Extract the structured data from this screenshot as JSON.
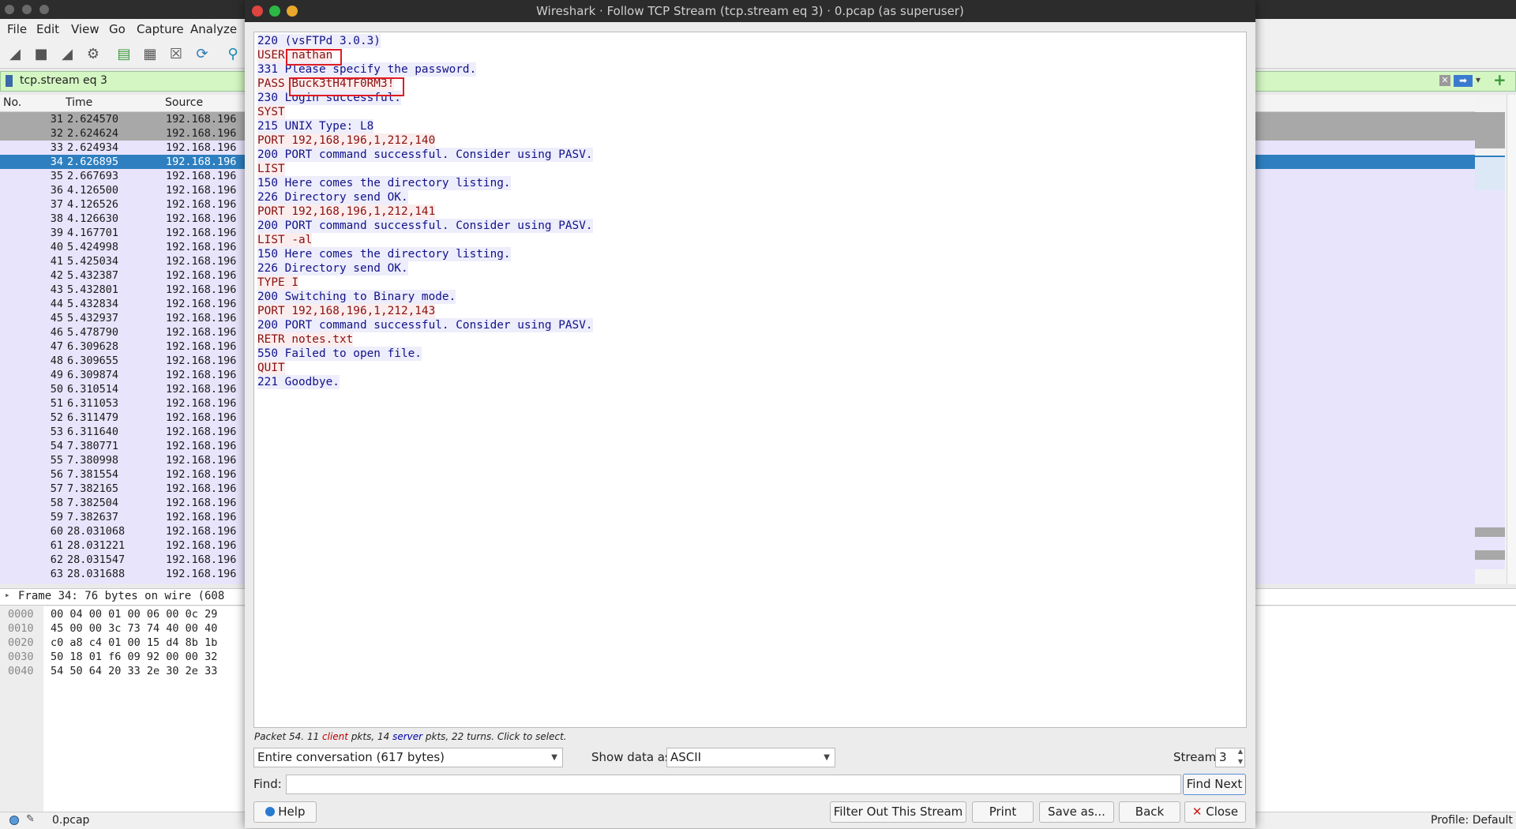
{
  "menu": [
    "File",
    "Edit",
    "View",
    "Go",
    "Capture",
    "Analyze"
  ],
  "filter": {
    "value": "tcp.stream eq 3"
  },
  "columns": {
    "no": "No.",
    "time": "Time",
    "source": "Source"
  },
  "packets": [
    {
      "no": "31",
      "time": "2.624570",
      "src": "192.168.196",
      "state": "gray"
    },
    {
      "no": "32",
      "time": "2.624624",
      "src": "192.168.196",
      "state": "gray"
    },
    {
      "no": "33",
      "time": "2.624934",
      "src": "192.168.196",
      "state": ""
    },
    {
      "no": "34",
      "time": "2.626895",
      "src": "192.168.196",
      "state": "sel"
    },
    {
      "no": "35",
      "time": "2.667693",
      "src": "192.168.196",
      "state": ""
    },
    {
      "no": "36",
      "time": "4.126500",
      "src": "192.168.196",
      "state": ""
    },
    {
      "no": "37",
      "time": "4.126526",
      "src": "192.168.196",
      "state": ""
    },
    {
      "no": "38",
      "time": "4.126630",
      "src": "192.168.196",
      "state": ""
    },
    {
      "no": "39",
      "time": "4.167701",
      "src": "192.168.196",
      "state": ""
    },
    {
      "no": "40",
      "time": "5.424998",
      "src": "192.168.196",
      "state": ""
    },
    {
      "no": "41",
      "time": "5.425034",
      "src": "192.168.196",
      "state": ""
    },
    {
      "no": "42",
      "time": "5.432387",
      "src": "192.168.196",
      "state": ""
    },
    {
      "no": "43",
      "time": "5.432801",
      "src": "192.168.196",
      "state": ""
    },
    {
      "no": "44",
      "time": "5.432834",
      "src": "192.168.196",
      "state": ""
    },
    {
      "no": "45",
      "time": "5.432937",
      "src": "192.168.196",
      "state": ""
    },
    {
      "no": "46",
      "time": "5.478790",
      "src": "192.168.196",
      "state": ""
    },
    {
      "no": "47",
      "time": "6.309628",
      "src": "192.168.196",
      "state": ""
    },
    {
      "no": "48",
      "time": "6.309655",
      "src": "192.168.196",
      "state": ""
    },
    {
      "no": "49",
      "time": "6.309874",
      "src": "192.168.196",
      "state": ""
    },
    {
      "no": "50",
      "time": "6.310514",
      "src": "192.168.196",
      "state": ""
    },
    {
      "no": "51",
      "time": "6.311053",
      "src": "192.168.196",
      "state": ""
    },
    {
      "no": "52",
      "time": "6.311479",
      "src": "192.168.196",
      "state": ""
    },
    {
      "no": "53",
      "time": "6.311640",
      "src": "192.168.196",
      "state": ""
    },
    {
      "no": "54",
      "time": "7.380771",
      "src": "192.168.196",
      "state": ""
    },
    {
      "no": "55",
      "time": "7.380998",
      "src": "192.168.196",
      "state": ""
    },
    {
      "no": "56",
      "time": "7.381554",
      "src": "192.168.196",
      "state": ""
    },
    {
      "no": "57",
      "time": "7.382165",
      "src": "192.168.196",
      "state": ""
    },
    {
      "no": "58",
      "time": "7.382504",
      "src": "192.168.196",
      "state": ""
    },
    {
      "no": "59",
      "time": "7.382637",
      "src": "192.168.196",
      "state": ""
    },
    {
      "no": "60",
      "time": "28.031068",
      "src": "192.168.196",
      "state": ""
    },
    {
      "no": "61",
      "time": "28.031221",
      "src": "192.168.196",
      "state": ""
    },
    {
      "no": "62",
      "time": "28.031547",
      "src": "192.168.196",
      "state": ""
    },
    {
      "no": "63",
      "time": "28.031688",
      "src": "192.168.196",
      "state": ""
    }
  ],
  "details": {
    "frame": "Frame 34: 76 bytes on wire (608"
  },
  "bytes": [
    {
      "off": "0000",
      "hex": "00 04 00 01 00 06 00 0c  29"
    },
    {
      "off": "0010",
      "hex": "45 00 00 3c 73 74 40 00  40"
    },
    {
      "off": "0020",
      "hex": "c0 a8 c4 01 00 15 d4 8b  1b"
    },
    {
      "off": "0030",
      "hex": "50 18 01 f6 09 92 00 00  32"
    },
    {
      "off": "0040",
      "hex": "54 50 64 20 33 2e 30 2e  33"
    }
  ],
  "status": {
    "file": "0.pcap",
    "profile": "Profile: Default"
  },
  "dialog": {
    "title": "Wireshark · Follow TCP Stream (tcp.stream eq 3) · 0.pcap (as superuser)",
    "stream": [
      {
        "text": "220 (vsFTPd 3.0.3)",
        "who": "server"
      },
      {
        "text": "USER nathan",
        "who": "client"
      },
      {
        "text": "331 Please specify the password.",
        "who": "server"
      },
      {
        "text": "PASS Buck3tH4TF0RM3!",
        "who": "client"
      },
      {
        "text": "230 Login successful.",
        "who": "server"
      },
      {
        "text": "SYST",
        "who": "client"
      },
      {
        "text": "215 UNIX Type: L8",
        "who": "server"
      },
      {
        "text": "PORT 192,168,196,1,212,140",
        "who": "client"
      },
      {
        "text": "200 PORT command successful. Consider using PASV.",
        "who": "server"
      },
      {
        "text": "LIST",
        "who": "client"
      },
      {
        "text": "150 Here comes the directory listing.",
        "who": "server"
      },
      {
        "text": "226 Directory send OK.",
        "who": "server"
      },
      {
        "text": "PORT 192,168,196,1,212,141",
        "who": "client"
      },
      {
        "text": "200 PORT command successful. Consider using PASV.",
        "who": "server"
      },
      {
        "text": "LIST -al",
        "who": "client"
      },
      {
        "text": "150 Here comes the directory listing.",
        "who": "server"
      },
      {
        "text": "226 Directory send OK.",
        "who": "server"
      },
      {
        "text": "TYPE I",
        "who": "client"
      },
      {
        "text": "200 Switching to Binary mode.",
        "who": "server"
      },
      {
        "text": "PORT 192,168,196,1,212,143",
        "who": "client"
      },
      {
        "text": "200 PORT command successful. Consider using PASV.",
        "who": "server"
      },
      {
        "text": "RETR notes.txt",
        "who": "client"
      },
      {
        "text": "550 Failed to open file.",
        "who": "server"
      },
      {
        "text": "QUIT",
        "who": "client"
      },
      {
        "text": "221 Goodbye.",
        "who": "server"
      }
    ],
    "info": {
      "prefix": "Packet 54. 11 ",
      "client": "client",
      "mid": " pkts, 14 ",
      "server": "server",
      "suffix": " pkts, 22 turns. Click to select."
    },
    "conversation": "Entire conversation (617 bytes)",
    "show_as_label": "Show data as",
    "show_as": "ASCII",
    "stream_label": "Stream",
    "stream_no": "3",
    "find_label": "Find:",
    "find_value": "",
    "buttons": {
      "find_next": "Find Next",
      "help": "Help",
      "filter_out": "Filter Out This Stream",
      "print": "Print",
      "save_as": "Save as...",
      "back": "Back",
      "close": "Close"
    }
  },
  "colors": {
    "client": "#8a1010",
    "server": "#12128a",
    "selected_row": "#2e7fc0",
    "filter_bg": "#d4f6c3"
  }
}
